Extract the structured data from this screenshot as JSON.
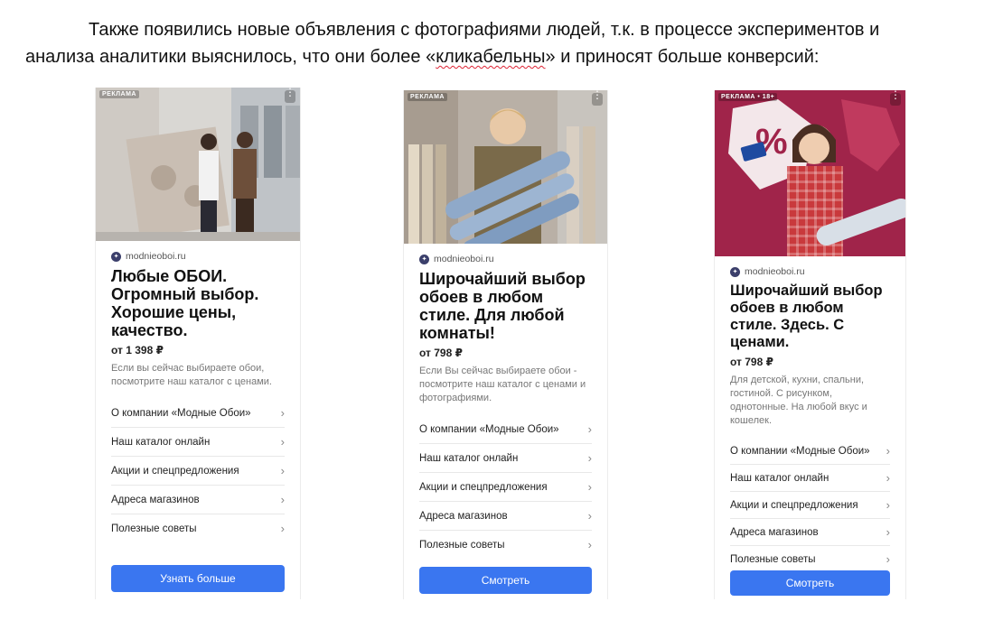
{
  "intro": {
    "line1": "Также появились новые объявления с фотографиями людей, т.к. в процессе экспериментов и",
    "line2_before": "анализа аналитики выяснилось, что они более «",
    "line2_marked": "кликабельны",
    "line2_after": "» и приносят больше конверсий:"
  },
  "ads": [
    {
      "ad_label": "РЕКЛАМА",
      "site": "modnieoboi.ru",
      "headline": "Любые ОБОИ. Огромный выбор. Хорошие цены, качество.",
      "price": "от 1 398 ₽",
      "description": "Если вы сейчас выбираете обои, посмотрите наш каталог с ценами.",
      "links": [
        "О компании «Модные Обои»",
        "Наш каталог онлайн",
        "Акции и спецпредложения",
        "Адреса магазинов",
        "Полезные советы"
      ],
      "button": "Узнать больше"
    },
    {
      "ad_label": "РЕКЛАМА",
      "site": "modnieoboi.ru",
      "headline": "Широчайший выбор обоев в любом стиле. Для любой комнаты!",
      "price": "от 798 ₽",
      "description": "Если Вы сейчас выбираете обои - посмотрите наш каталог с ценами и фотографиями.",
      "links": [
        "О компании «Модные Обои»",
        "Наш каталог онлайн",
        "Акции и спецпредложения",
        "Адреса магазинов",
        "Полезные советы"
      ],
      "button": "Смотреть"
    },
    {
      "ad_label": "РЕКЛАМА • 18+",
      "site": "modnieoboi.ru",
      "headline": "Широчайший выбор обоев в любом стиле. Здесь. С ценами.",
      "price": "от 798 ₽",
      "description": "Для детской, кухни, спальни, гостиной. С рисунком, однотонные. На любой вкус и кошелек.",
      "links": [
        "О компании «Модные Обои»",
        "Наш каталог онлайн",
        "Акции и спецпредложения",
        "Адреса магазинов",
        "Полезные советы"
      ],
      "button": "Смотреть"
    }
  ],
  "colors": {
    "button": "#3a76f0",
    "ad3_photo_bg": "#a0244a"
  }
}
